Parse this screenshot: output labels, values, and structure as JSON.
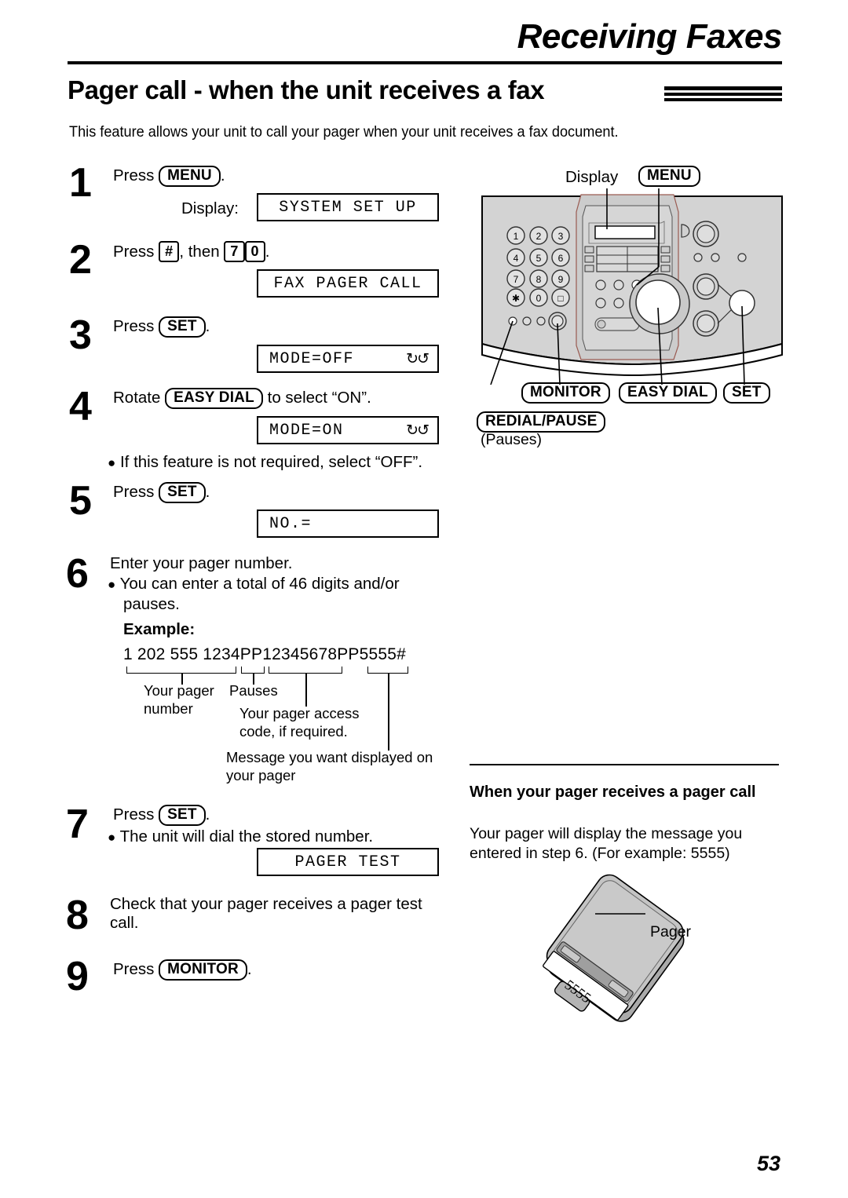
{
  "header": {
    "chapter_title": "Receiving Faxes",
    "section_title": "Pager call - when the unit receives a fax",
    "intro": "This feature allows your unit to call your pager when your unit receives a fax document."
  },
  "steps": [
    {
      "num": "1",
      "press_label": "Press",
      "key": "MENU",
      "period": ".",
      "display_label": "Display:",
      "lcd": "SYSTEM SET UP",
      "lcd_rotate": false
    },
    {
      "num": "2",
      "press_label": "Press",
      "key": "#",
      "then_label": ", then",
      "key2": "7",
      "key3": "0",
      "period": ".",
      "lcd": "FAX PAGER CALL",
      "lcd_rotate": false
    },
    {
      "num": "3",
      "press_label": "Press",
      "key": "SET",
      "period": ".",
      "lcd": "MODE=OFF",
      "lcd_rotate": true
    },
    {
      "num": "4",
      "press_label": "Rotate",
      "key": "EASY DIAL",
      "suffix": "to select “ON”.",
      "lcd": "MODE=ON",
      "lcd_rotate": true,
      "bullet": "If this feature is not required, select “OFF”."
    },
    {
      "num": "5",
      "press_label": "Press",
      "key": "SET",
      "period": ".",
      "lcd": "NO.=",
      "lcd_rotate": false
    },
    {
      "num": "6",
      "line1": "Enter your pager number.",
      "bullet1": "You can enter a total of 46 digits and/or",
      "bullet1b": "pauses.",
      "example_label": "Example:",
      "example_number": "1 202 555 1234PP12345678PP5555#",
      "annotations": [
        "Your pager",
        "number",
        "Pauses",
        "Your pager access",
        "code, if required.",
        "Message you want displayed on",
        "your pager"
      ]
    },
    {
      "num": "7",
      "press_label": "Press",
      "key": "SET",
      "period": ".",
      "bullet": "The unit will dial the stored number.",
      "lcd": "PAGER TEST",
      "lcd_rotate": false
    },
    {
      "num": "8",
      "line1": "Check that your pager receives a pager test",
      "line2": "call."
    },
    {
      "num": "9",
      "press_label": "Press",
      "key": "MONITOR",
      "period": "."
    }
  ],
  "diagram": {
    "display_label": "Display",
    "menu_key": "MENU",
    "keypad": [
      "1",
      "2",
      "3",
      "4",
      "5",
      "6",
      "7",
      "8",
      "9",
      "∗",
      "0",
      "□"
    ],
    "callouts": [
      {
        "label": "MONITOR"
      },
      {
        "label": "EASY DIAL"
      },
      {
        "label": "SET"
      },
      {
        "label": "REDIAL/PAUSE"
      }
    ],
    "pauses_note": "(Pauses)"
  },
  "pager_section": {
    "heading": "When your pager receives a pager call",
    "body_line1": "Your pager will display the message you",
    "body_line2": "entered in step 6. (For example: 5555)",
    "pager_label": "Pager",
    "pager_display": "5555"
  },
  "footer": {
    "page_number": "53"
  },
  "colors": {
    "ink": "#000000",
    "panel_gray": "#d3d3d3",
    "panel_gray_dark": "#b9b9b9",
    "pager_gray": "#c4c4c4"
  }
}
